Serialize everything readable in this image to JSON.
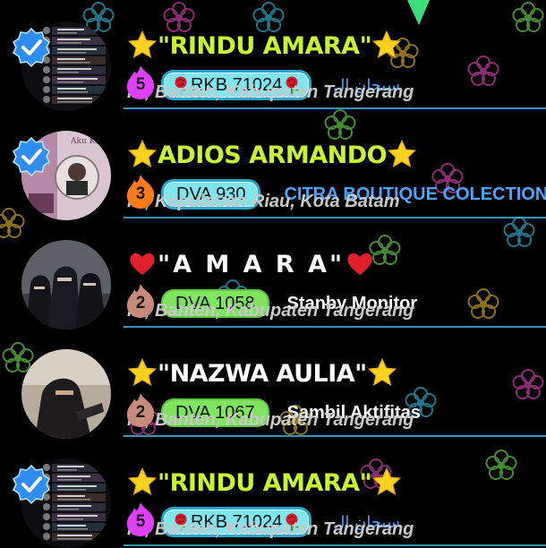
{
  "rows": [
    {
      "name": "\"RINDU AMARA\"",
      "name_color": "#c7f530",
      "prefix_icon": "star-icon",
      "suffix_icon": "star-icon",
      "level": "5",
      "level_color": "#e040fb",
      "badge": "RKB 71024",
      "badge_style": "cyan",
      "badge_icons": "rose-icon",
      "extra": "سبحان ال",
      "extra_style": "arabic",
      "location": "ID, Banten, Kabupaten Tangerang",
      "verified": true,
      "avatar": "collage"
    },
    {
      "name": "ADIOS ARMANDO",
      "name_color": "#c7f530",
      "prefix_icon": "star-icon",
      "suffix_icon": "star-icon",
      "level": "3",
      "level_color": "#ff7a1a",
      "badge": "DVA 930",
      "badge_style": "cyan",
      "badge_icons": "",
      "extra": "CITRA BOUTIQUE COLECTION",
      "extra_style": "blue",
      "location": "ID, Kepulauan Riau, Kota Batam",
      "verified": true,
      "avatar": "portrait"
    },
    {
      "name": "\"A M A R A\"",
      "name_color": "#ffffff",
      "prefix_icon": "heart-icon",
      "suffix_icon": "heart-icon",
      "level": "2",
      "level_color": "#c98a7a",
      "badge": "DVA 1058",
      "badge_style": "green",
      "badge_icons": "",
      "extra": "Stanby Monitor",
      "extra_style": "white",
      "location": "ID, Banten, Kabupaten Tangerang",
      "verified": false,
      "avatar": "group"
    },
    {
      "name": "\"NAZWA AULIA\"",
      "name_color": "#ffffff",
      "prefix_icon": "star-icon",
      "suffix_icon": "star-icon",
      "level": "2",
      "level_color": "#c98a7a",
      "badge": "DVA 1067",
      "badge_style": "green",
      "badge_icons": "",
      "extra": "Sambil Aktifitas",
      "extra_style": "white",
      "location": "ID, Banten, Kabupaten Tangerang",
      "verified": false,
      "avatar": "single"
    },
    {
      "name": "\"RINDU AMARA\"",
      "name_color": "#c7f530",
      "prefix_icon": "star-icon",
      "suffix_icon": "star-icon",
      "level": "5",
      "level_color": "#e040fb",
      "badge": "RKB 71024",
      "badge_style": "cyan",
      "badge_icons": "rose-icon",
      "extra": "سبحان ال",
      "extra_style": "arabic",
      "location": "ID, Banten, Kabupaten Tangerang",
      "verified": true,
      "avatar": "collage"
    }
  ],
  "colors": {
    "divider": "#4fc3e8",
    "location": "#c8c8c8",
    "star": "#ffd21f",
    "heart": "#e0202a"
  }
}
